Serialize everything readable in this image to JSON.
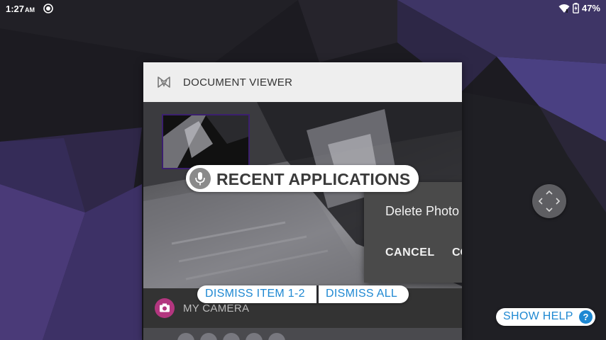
{
  "status_bar": {
    "time": "1:27",
    "ampm": "AM",
    "battery": "47%"
  },
  "recents": {
    "card_title": "DOCUMENT VIEWER",
    "dialog": {
      "message": "Delete Photo",
      "cancel_label": "CANCEL",
      "confirm_label": "CO"
    },
    "second_card_title": "MY CAMERA"
  },
  "overlay": {
    "recent_applications_label": "RECENT APPLICATIONS",
    "dismiss_item_label": "DISMISS ITEM 1-2",
    "dismiss_all_label": "DISMISS ALL",
    "show_help_label": "SHOW HELP",
    "help_badge": "?"
  },
  "icons": {
    "status_left": "sync-circle-icon",
    "wifi": "wifi-icon",
    "battery": "battery-charging-icon",
    "app": "document-viewer-icon",
    "camera": "camera-icon",
    "mic": "microphone-icon",
    "joystick": "navigation-arrows-icon"
  },
  "colors": {
    "accent": "#1e88d2",
    "camera_app": "#b3367f",
    "header_bg": "#eeeeee"
  }
}
